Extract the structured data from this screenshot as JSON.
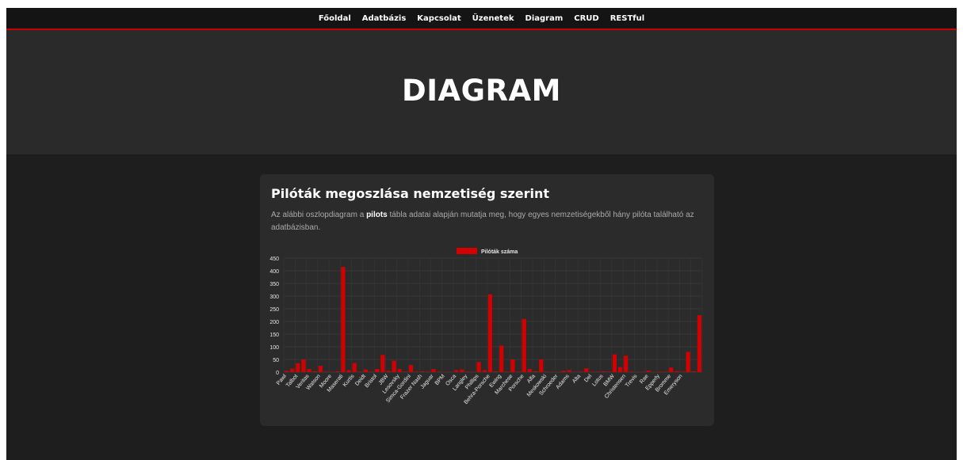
{
  "nav": {
    "items": [
      "Főoldal",
      "Adatbázis",
      "Kapcsolat",
      "Üzenetek",
      "Diagram",
      "CRUD",
      "RESTful"
    ]
  },
  "hero": {
    "title": "DIAGRAM"
  },
  "card": {
    "title": "Pilóták megoszlása nemzetiség szerint",
    "desc_pre": "Az alábbi oszlopdiagram a ",
    "desc_bold": "pilots",
    "desc_post": " tábla adatai alapján mutatja meg, hogy egyes nemzetiségekből hány pilóta található az adatbázisban."
  },
  "colors": {
    "accent": "#c80000",
    "bar": "#d40000",
    "frame_bg": "#1e1e1e",
    "hero_bg": "#2a2a2a",
    "card_bg": "#2b2b2b"
  },
  "chart_data": {
    "type": "bar",
    "legend": "Pilóták száma",
    "legend_position": "top",
    "grid": true,
    "ylim": [
      0,
      450
    ],
    "yticks": [
      0,
      50,
      100,
      150,
      200,
      250,
      300,
      350,
      400,
      450
    ],
    "categories": [
      "Pawl",
      "",
      "Talbot",
      "",
      "Veritas",
      "",
      "Watson",
      "",
      "Moore",
      "",
      "Maserati",
      "",
      "Kurtis",
      "",
      "Deidt",
      "",
      "Bristol",
      "",
      "JBW",
      "",
      "Lesovsky",
      "",
      "Simca-Gordini",
      "",
      "Frazer Nash",
      "",
      "Jaguar",
      "",
      "BPM",
      "",
      "Osca",
      "",
      "Langley",
      "",
      "Phillips",
      "",
      "Behra-Porsche",
      "",
      "Ewing",
      "",
      "Marchese",
      "",
      "Porsche",
      "",
      "Alfa",
      "",
      "Meskowski",
      "",
      "Schroeder",
      "",
      "Adams",
      "",
      "Alta",
      "",
      "Del",
      "",
      "Lotus",
      "",
      "BMW",
      "",
      "Christensen",
      "",
      "Trevis",
      "",
      "Rae",
      "",
      "Epperly",
      "",
      "Bromme",
      "",
      "Emeryson"
    ],
    "values": [
      5,
      14,
      35,
      50,
      12,
      3,
      25,
      2,
      1,
      3,
      415,
      8,
      36,
      2,
      10,
      2,
      12,
      68,
      5,
      45,
      12,
      2,
      28,
      2,
      3,
      2,
      12,
      2,
      1,
      1,
      8,
      10,
      2,
      1,
      40,
      8,
      307,
      3,
      105,
      2,
      50,
      2,
      210,
      12,
      3,
      50,
      2,
      1,
      1,
      5,
      8,
      1,
      2,
      15,
      2,
      2,
      3,
      2,
      70,
      20,
      65,
      2,
      1,
      1,
      6,
      1,
      2,
      2,
      18,
      4,
      2,
      80,
      3,
      225
    ]
  }
}
